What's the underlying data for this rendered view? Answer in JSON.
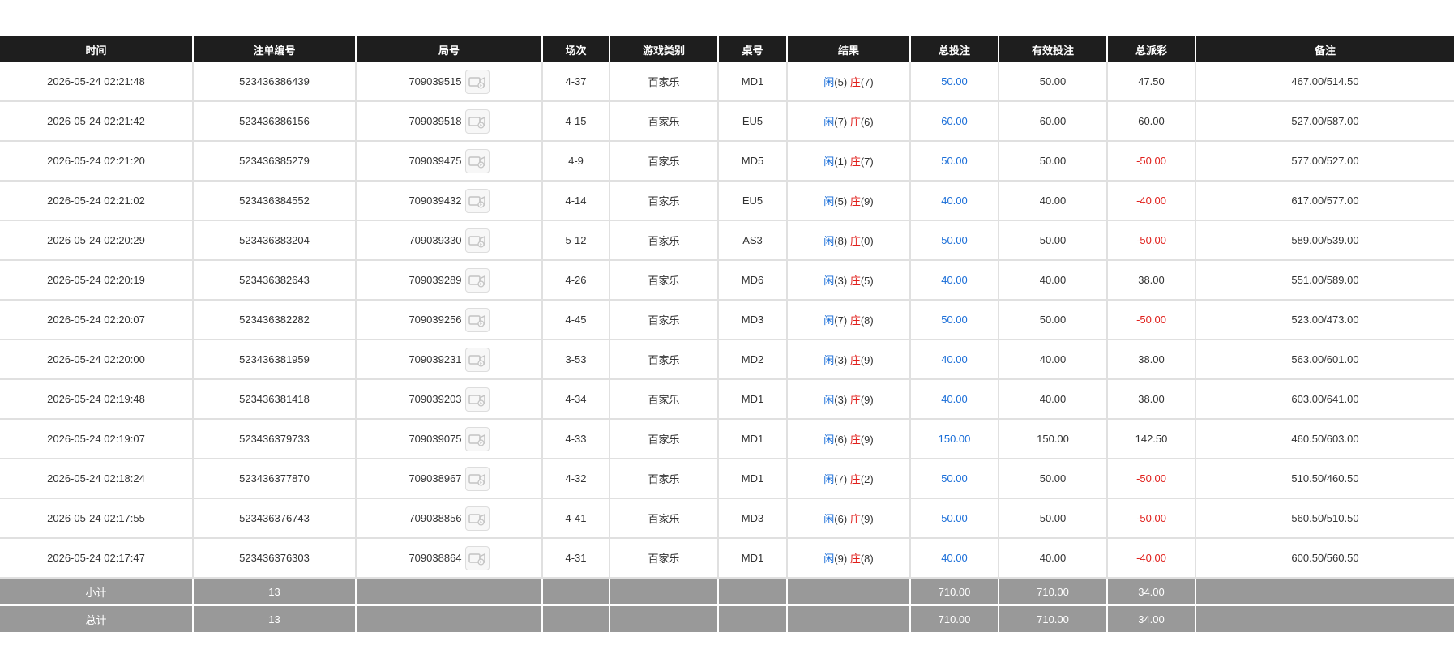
{
  "headers": [
    "时间",
    "注单编号",
    "局号",
    "场次",
    "游戏类别",
    "桌号",
    "结果",
    "总投注",
    "有效投注",
    "总派彩",
    "备注"
  ],
  "player_label": "闲",
  "banker_label": "庄",
  "colors": {
    "header_bg": "#1e1e1e",
    "summary_bg": "#999999",
    "positive_blue": "#1a6ed8",
    "negative_red": "#e0201c",
    "border": "#e0e0e0"
  },
  "rows": [
    {
      "time": "2026-05-24 02:21:48",
      "bet_id": "523436386439",
      "round": "709039515",
      "shoe": "4-37",
      "game": "百家乐",
      "table": "MD1",
      "player": "(5)",
      "banker": "(7)",
      "total_bet": "50.00",
      "valid_bet": "50.00",
      "payout": "47.50",
      "payout_negative": false,
      "note": "467.00/514.50"
    },
    {
      "time": "2026-05-24 02:21:42",
      "bet_id": "523436386156",
      "round": "709039518",
      "shoe": "4-15",
      "game": "百家乐",
      "table": "EU5",
      "player": "(7)",
      "banker": "(6)",
      "total_bet": "60.00",
      "valid_bet": "60.00",
      "payout": "60.00",
      "payout_negative": false,
      "note": "527.00/587.00"
    },
    {
      "time": "2026-05-24 02:21:20",
      "bet_id": "523436385279",
      "round": "709039475",
      "shoe": "4-9",
      "game": "百家乐",
      "table": "MD5",
      "player": "(1)",
      "banker": "(7)",
      "total_bet": "50.00",
      "valid_bet": "50.00",
      "payout": "-50.00",
      "payout_negative": true,
      "note": "577.00/527.00"
    },
    {
      "time": "2026-05-24 02:21:02",
      "bet_id": "523436384552",
      "round": "709039432",
      "shoe": "4-14",
      "game": "百家乐",
      "table": "EU5",
      "player": "(5)",
      "banker": "(9)",
      "total_bet": "40.00",
      "valid_bet": "40.00",
      "payout": "-40.00",
      "payout_negative": true,
      "note": "617.00/577.00"
    },
    {
      "time": "2026-05-24 02:20:29",
      "bet_id": "523436383204",
      "round": "709039330",
      "shoe": "5-12",
      "game": "百家乐",
      "table": "AS3",
      "player": "(8)",
      "banker": "(0)",
      "total_bet": "50.00",
      "valid_bet": "50.00",
      "payout": "-50.00",
      "payout_negative": true,
      "note": "589.00/539.00"
    },
    {
      "time": "2026-05-24 02:20:19",
      "bet_id": "523436382643",
      "round": "709039289",
      "shoe": "4-26",
      "game": "百家乐",
      "table": "MD6",
      "player": "(3)",
      "banker": "(5)",
      "total_bet": "40.00",
      "valid_bet": "40.00",
      "payout": "38.00",
      "payout_negative": false,
      "note": "551.00/589.00"
    },
    {
      "time": "2026-05-24 02:20:07",
      "bet_id": "523436382282",
      "round": "709039256",
      "shoe": "4-45",
      "game": "百家乐",
      "table": "MD3",
      "player": "(7)",
      "banker": "(8)",
      "total_bet": "50.00",
      "valid_bet": "50.00",
      "payout": "-50.00",
      "payout_negative": true,
      "note": "523.00/473.00"
    },
    {
      "time": "2026-05-24 02:20:00",
      "bet_id": "523436381959",
      "round": "709039231",
      "shoe": "3-53",
      "game": "百家乐",
      "table": "MD2",
      "player": "(3)",
      "banker": "(9)",
      "total_bet": "40.00",
      "valid_bet": "40.00",
      "payout": "38.00",
      "payout_negative": false,
      "note": "563.00/601.00"
    },
    {
      "time": "2026-05-24 02:19:48",
      "bet_id": "523436381418",
      "round": "709039203",
      "shoe": "4-34",
      "game": "百家乐",
      "table": "MD1",
      "player": "(3)",
      "banker": "(9)",
      "total_bet": "40.00",
      "valid_bet": "40.00",
      "payout": "38.00",
      "payout_negative": false,
      "note": "603.00/641.00"
    },
    {
      "time": "2026-05-24 02:19:07",
      "bet_id": "523436379733",
      "round": "709039075",
      "shoe": "4-33",
      "game": "百家乐",
      "table": "MD1",
      "player": "(6)",
      "banker": "(9)",
      "total_bet": "150.00",
      "valid_bet": "150.00",
      "payout": "142.50",
      "payout_negative": false,
      "note": "460.50/603.00"
    },
    {
      "time": "2026-05-24 02:18:24",
      "bet_id": "523436377870",
      "round": "709038967",
      "shoe": "4-32",
      "game": "百家乐",
      "table": "MD1",
      "player": "(7)",
      "banker": "(2)",
      "total_bet": "50.00",
      "valid_bet": "50.00",
      "payout": "-50.00",
      "payout_negative": true,
      "note": "510.50/460.50"
    },
    {
      "time": "2026-05-24 02:17:55",
      "bet_id": "523436376743",
      "round": "709038856",
      "shoe": "4-41",
      "game": "百家乐",
      "table": "MD3",
      "player": "(6)",
      "banker": "(9)",
      "total_bet": "50.00",
      "valid_bet": "50.00",
      "payout": "-50.00",
      "payout_negative": true,
      "note": "560.50/510.50"
    },
    {
      "time": "2026-05-24 02:17:47",
      "bet_id": "523436376303",
      "round": "709038864",
      "shoe": "4-31",
      "game": "百家乐",
      "table": "MD1",
      "player": "(9)",
      "banker": "(8)",
      "total_bet": "40.00",
      "valid_bet": "40.00",
      "payout": "-40.00",
      "payout_negative": true,
      "note": "600.50/560.50"
    }
  ],
  "subtotal": {
    "label": "小计",
    "count": "13",
    "total_bet": "710.00",
    "valid_bet": "710.00",
    "payout": "34.00"
  },
  "total": {
    "label": "总计",
    "count": "13",
    "total_bet": "710.00",
    "valid_bet": "710.00",
    "payout": "34.00"
  }
}
